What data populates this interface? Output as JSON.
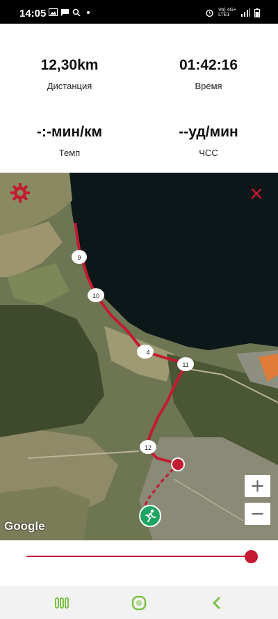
{
  "status_bar": {
    "time": "14:05",
    "left_icons": [
      "image-icon",
      "chat-icon",
      "search-icon",
      "dot-icon"
    ],
    "network_text": "Vo) 4G+\nLTE1",
    "right_icons": [
      "alarm-icon",
      "signal-icon",
      "battery-icon"
    ]
  },
  "stats": {
    "distance": {
      "value": "12,30km",
      "label": "Дистанция"
    },
    "time": {
      "value": "01:42:16",
      "label": "Время"
    },
    "pace": {
      "value": "-:-мин/км",
      "label": "Темп"
    },
    "heart_rate": {
      "value": "--уд/мин",
      "label": "ЧСС"
    }
  },
  "map": {
    "markers": [
      "9",
      "10",
      "4",
      "11",
      "12"
    ],
    "zoom_in": "+",
    "zoom_out": "−",
    "attribution": "Google",
    "route_color": "#c21b32",
    "runner_marker_color": "#1fa463"
  },
  "playback": {
    "progress": 1.0,
    "accent": "#c21b32"
  },
  "nav": {
    "icons": [
      "recent-apps-icon",
      "home-icon",
      "back-icon"
    ],
    "accent": "#7bc043"
  }
}
